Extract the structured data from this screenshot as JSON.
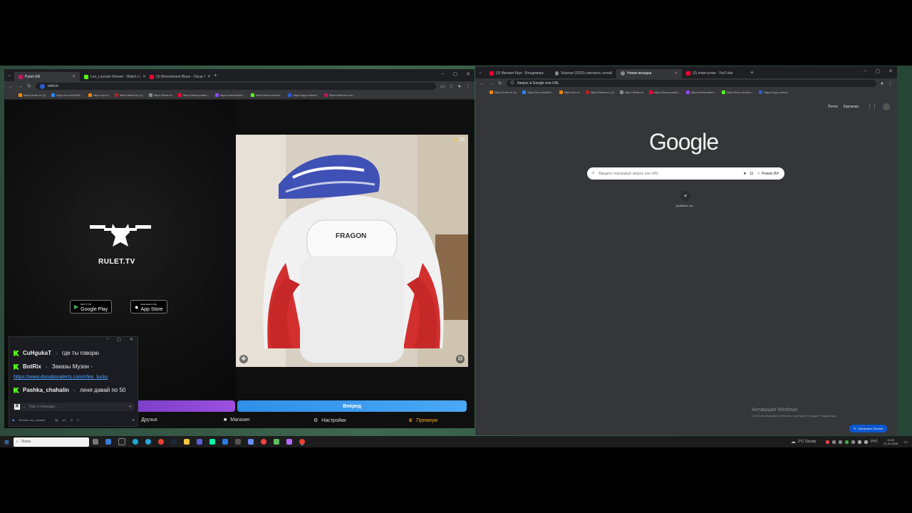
{
  "left_browser": {
    "tabs": [
      {
        "label": "Рулет ЕБ",
        "icon_color": "#c2185b",
        "active": true
      },
      {
        "label": "Leo_Lacoste Stream - Watch Li",
        "icon_color": "#53fc18",
        "active": false
      },
      {
        "label": "(3) Borsonhurst Blues - Oscar I",
        "icon_color": "#ff0033",
        "active": false
      }
    ],
    "url": "rulet.tv",
    "bookmarks": [
      "https://mail.ru/ (1)",
      "https://vk.com/al18...",
      "https://ok.ru/",
      "https://tanki.su/ (1)",
      "https://lesta.ru/",
      "https://www.youtub...",
      "https://www.twitch...",
      "https://kick.com/leo...",
      "https://app.rentrea...",
      "https://stoirroo.mo/..."
    ]
  },
  "rulet": {
    "logo_text": "RULET.TV",
    "google_play": {
      "small": "GET IT ON",
      "big": "Google Play"
    },
    "app_store": {
      "small": "Download on the",
      "big": "App Store"
    },
    "star_count": "25",
    "next_button": "Вперед",
    "menu": [
      "Друзья",
      "Магазин",
      "Настройки",
      "Премиум"
    ]
  },
  "chat": {
    "messages": [
      {
        "user": "CuHgukaT",
        "text": "где ты говорю"
      },
      {
        "user": "BotRix",
        "text": "Заказы Музон -"
      },
      {
        "user": "",
        "link": "https://www.donationalerts.com/r/leo_lucky"
      },
      {
        "user": "Pashka_chahalin",
        "text": "леня давай по 50"
      }
    ],
    "input_placeholder": "Type a message...",
    "footer_channel": "Stream Leo_Lacoste",
    "footer_count": "1/1",
    "footer_viewers": "5"
  },
  "right_browser": {
    "tabs": [
      {
        "label": "(3) Михаил Круг - Владимирс",
        "icon_color": "#ff0033",
        "active": false
      },
      {
        "label": "Ушатые (2025) смотреть онлай",
        "icon_color": "#888888",
        "active": false
      },
      {
        "label": "Новая вкладка",
        "icon_color": "#888888",
        "active": true
      },
      {
        "label": "(3) лови кучик - YouTube",
        "icon_color": "#ff0033",
        "active": false
      }
    ],
    "omnibox": "Запрос в Google или URL",
    "bookmarks": [
      "https://mail.ru/ (1)",
      "https://vk.com/al18...",
      "https://ok.ru/",
      "https://tanki.su/ (1)",
      "https://lesta.ru/",
      "https://www.youtub...",
      "https://www.twitch...",
      "https://kick.com/leo...",
      "https://app.rentrea..."
    ],
    "top_links": [
      "Почта",
      "Картинки"
    ],
    "google_logo": "Google",
    "search_placeholder": "Введите поисковый запрос или URL",
    "ai_mode": "Режим ИИ",
    "shortcut_label": "Добавить яр...",
    "activate_title": "Активация Windows",
    "activate_sub": "Чтобы активировать Windows, перейдите в раздел \"Параметры\".",
    "customize_button": "Настроить Chrome"
  },
  "taskbar": {
    "search_placeholder": "Поиск",
    "weather": "2°C  Cloudy",
    "lang": "РУС",
    "time": "10:22",
    "date": "01.01.2026"
  }
}
